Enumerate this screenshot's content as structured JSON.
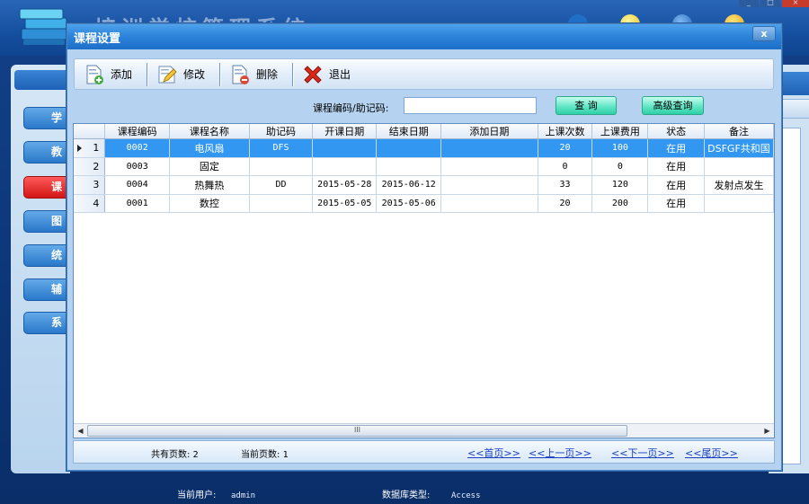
{
  "dialog": {
    "title": "课程设置",
    "close_label": "x"
  },
  "toolbar": {
    "add_label": "添加",
    "edit_label": "修改",
    "delete_label": "删除",
    "exit_label": "退出"
  },
  "search": {
    "label": "课程编码/助记码:",
    "value": "",
    "query_label": "查  询",
    "advanced_label": "高级查询"
  },
  "grid": {
    "columns": [
      "课程编码",
      "课程名称",
      "助记码",
      "开课日期",
      "结束日期",
      "添加日期",
      "上课次数",
      "上课费用",
      "状态",
      "备注"
    ],
    "rows": [
      {
        "index": "1",
        "code": "0002",
        "name": "电风扇",
        "mnemonic": "DFS",
        "start": "",
        "end": "",
        "added": "",
        "times": "20",
        "fee": "100",
        "status": "在用",
        "note": "DSFGF共和国"
      },
      {
        "index": "2",
        "code": "0003",
        "name": "固定",
        "mnemonic": "",
        "start": "",
        "end": "",
        "added": "",
        "times": "0",
        "fee": "0",
        "status": "在用",
        "note": ""
      },
      {
        "index": "3",
        "code": "0004",
        "name": "热舞热",
        "mnemonic": "DD",
        "start": "2015-05-28",
        "end": "2015-06-12",
        "added": "",
        "times": "33",
        "fee": "120",
        "status": "在用",
        "note": "发射点发生"
      },
      {
        "index": "4",
        "code": "0001",
        "name": "数控",
        "mnemonic": "",
        "start": "2015-05-05",
        "end": "2015-05-06",
        "added": "",
        "times": "20",
        "fee": "200",
        "status": "在用",
        "note": ""
      }
    ],
    "selected_row": 0,
    "scroll_thumb": "III"
  },
  "pager": {
    "total_label": "共有页数:",
    "total_value": "2",
    "current_label": "当前页数:",
    "current_value": "1",
    "first": "<<首页>>",
    "prev": "<<上一页>>",
    "next": "<<下一页>>",
    "last": "<<尾页>>"
  },
  "app": {
    "title": "培训学校管理系统",
    "sidebar_items": [
      "学",
      "教",
      "课",
      "图",
      "统",
      "辅",
      "系"
    ],
    "active_sidebar_index": 2,
    "status_user_label": "当前用户:",
    "status_user_value": "admin",
    "status_db_label": "数据库类型:",
    "status_db_value": "Access"
  },
  "colors": {
    "selection": "#3297f0",
    "titlebar": "#2d84da",
    "sidebar_active": "#d21515",
    "link": "#1a3fbf"
  }
}
